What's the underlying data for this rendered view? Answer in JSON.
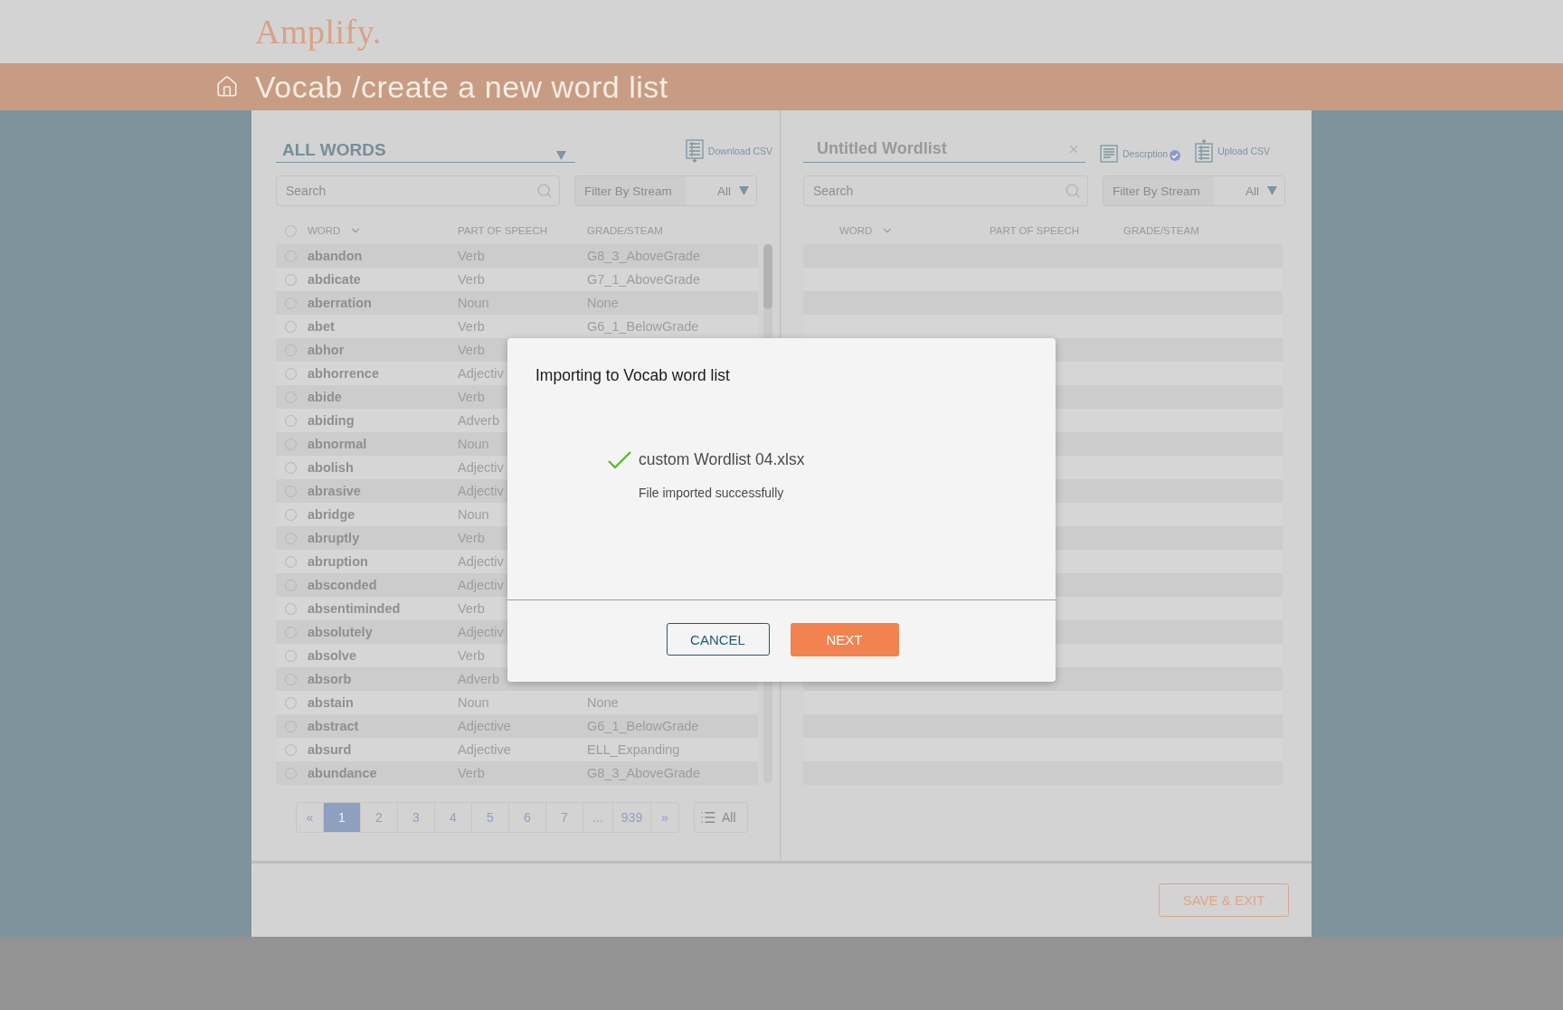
{
  "header": {
    "logo": "Amplify."
  },
  "title_bar": {
    "title": "Vocab /create a new word list"
  },
  "left_panel": {
    "list_select": "ALL WORDS",
    "download": "Download CSV",
    "search": {
      "placeholder": "Search"
    },
    "filter": {
      "label": "Filter By Stream",
      "value": "All"
    },
    "select_all": {
      "checked": false
    },
    "columns": [
      "WORD",
      "PART OF SPEECH",
      "GRADE/STEAM"
    ],
    "rows": [
      {
        "word": "abandon",
        "part_of_speech": "Verb",
        "grade": "G8_3_AboveGrade",
        "checked": false
      },
      {
        "word": "abdicate",
        "part_of_speech": "Verb",
        "grade": "G7_1_AboveGrade",
        "checked": false
      },
      {
        "word": "aberration",
        "part_of_speech": "Noun",
        "grade": "None",
        "checked": false
      },
      {
        "word": "abet",
        "part_of_speech": "Verb",
        "grade": "G6_1_BelowGrade",
        "checked": false
      },
      {
        "word": "abhor",
        "part_of_speech": "Verb",
        "checked": false
      },
      {
        "word": "abhorrence",
        "part_of_speech": "Adjectiv",
        "checked": false
      },
      {
        "word": "abide",
        "part_of_speech": "Verb",
        "checked": false
      },
      {
        "word": "abiding",
        "part_of_speech": "Adverb",
        "checked": false
      },
      {
        "word": "abnormal",
        "part_of_speech": "Noun",
        "checked": false
      },
      {
        "word": "abolish",
        "part_of_speech": "Adjectiv",
        "checked": false
      },
      {
        "word": "abrasive",
        "part_of_speech": "Adjectiv",
        "checked": false
      },
      {
        "word": "abridge",
        "part_of_speech": "Noun",
        "checked": false
      },
      {
        "word": "abruptly",
        "part_of_speech": "Verb",
        "checked": false
      },
      {
        "word": "abruption",
        "part_of_speech": "Adjectiv",
        "checked": false
      },
      {
        "word": "absconded",
        "part_of_speech": "Adjectiv",
        "checked": false
      },
      {
        "word": "absentiminded",
        "part_of_speech": "Verb",
        "checked": false
      },
      {
        "word": "absolutely",
        "part_of_speech": "Adjectiv",
        "checked": false
      },
      {
        "word": "absolve",
        "part_of_speech": "Verb",
        "checked": false
      },
      {
        "word": "absorb",
        "part_of_speech": "Adverb",
        "checked": false
      },
      {
        "word": "abstain",
        "part_of_speech": "Noun",
        "grade": "None",
        "checked": false
      },
      {
        "word": "abstract",
        "part_of_speech": "Adjective",
        "grade": "G6_1_BelowGrade",
        "checked": false
      },
      {
        "word": "absurd",
        "part_of_speech": "Adjective",
        "grade": "ELL_Expanding",
        "checked": false
      },
      {
        "word": "abundance",
        "part_of_speech": "Verb",
        "grade": "G8_3_AboveGrade",
        "checked": false
      }
    ],
    "pagination": {
      "prev": "«",
      "pages": [
        {
          "label": "1",
          "selected": true
        },
        {
          "label": "2",
          "selected": false
        },
        {
          "label": "3",
          "selected": false
        },
        {
          "label": "4",
          "selected": false
        },
        {
          "label": "5",
          "selected": false
        },
        {
          "label": "6",
          "selected": false
        },
        {
          "label": "7",
          "selected": false
        },
        {
          "label": "...",
          "selected": false
        },
        {
          "label": "939",
          "selected": false
        }
      ],
      "next": "»"
    },
    "view_all": "All"
  },
  "right_panel": {
    "title_field": {
      "value": "Untitled Wordlist"
    },
    "description": "Descrption",
    "upload": "Upload CSV",
    "search": {
      "placeholder": "Search"
    },
    "filter": {
      "label": "Filter By Stream",
      "value": "All"
    },
    "columns": [
      "WORD",
      "PART OF SPEECH",
      "GRADE/STEAM"
    ]
  },
  "dialog": {
    "title": "Importing to Vocab word list",
    "file_name": "custom Wordlist 04.xlsx",
    "message": "File imported successfully",
    "buttons": [
      {
        "label": "CANCEL",
        "kind": "secondary"
      },
      {
        "label": "NEXT",
        "kind": "primary"
      }
    ]
  },
  "footer": {
    "save_button": "SAVE & EXIT"
  }
}
